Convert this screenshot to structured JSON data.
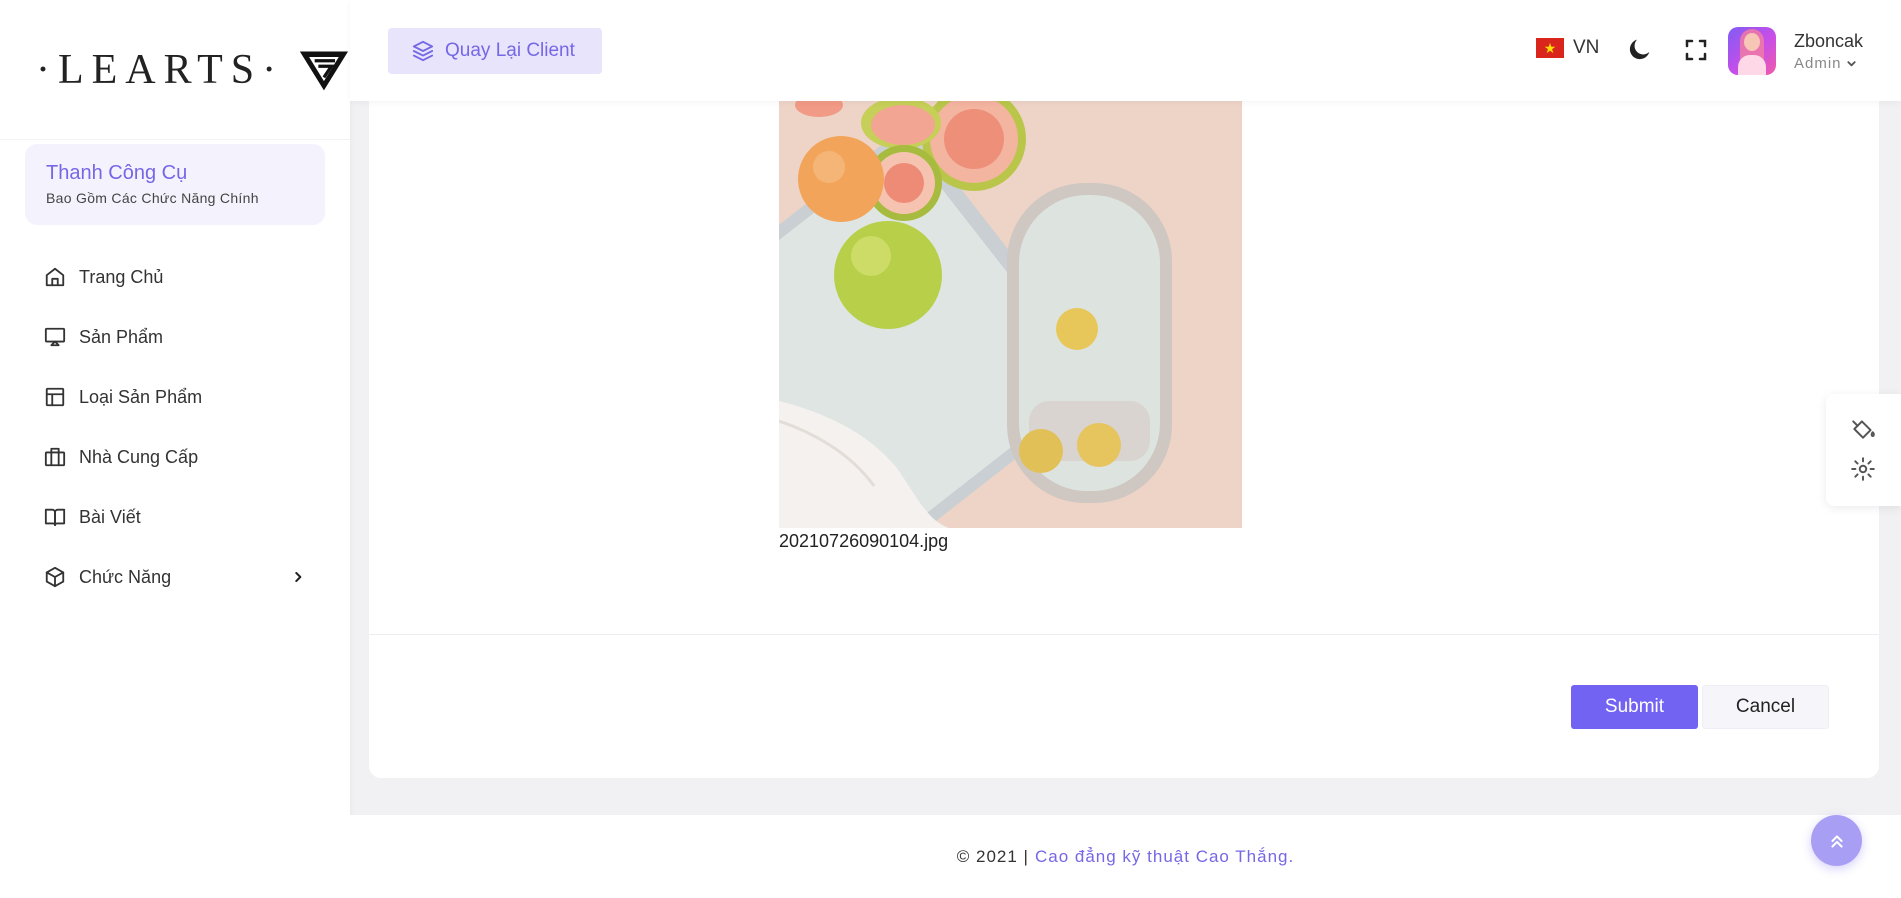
{
  "brand": {
    "logo_text": "·LEARTS·",
    "logo_mark": "logo-mark"
  },
  "sidebar": {
    "toolbar_title": "Thanh Công Cụ",
    "toolbar_subtitle": "Bao Gồm Các Chức Năng Chính",
    "items": [
      {
        "label": "Trang Chủ",
        "icon": "home-icon"
      },
      {
        "label": "Sản Phẩm",
        "icon": "monitor-icon"
      },
      {
        "label": "Loại Sản Phẩm",
        "icon": "layout-icon"
      },
      {
        "label": "Nhà Cung Cấp",
        "icon": "briefcase-icon"
      },
      {
        "label": "Bài Viết",
        "icon": "book-icon"
      },
      {
        "label": "Chức Năng",
        "icon": "box-icon",
        "has_submenu": true
      }
    ]
  },
  "header": {
    "back_button_label": "Quay Lại Client",
    "language": "VN",
    "user_name": "Zboncak",
    "user_role": "Admin"
  },
  "content": {
    "image_file_name": "20210726090104.jpg",
    "submit_label": "Submit",
    "cancel_label": "Cancel"
  },
  "footer": {
    "copyright": "© 2021 |",
    "link_text": "Cao đẳng kỹ thuật Cao Thắng."
  },
  "colors": {
    "accent": "#7363f2",
    "accent_light": "#e7e4fb",
    "sidebar_bg": "#ffffff",
    "page_bg": "#f1f1f3"
  }
}
